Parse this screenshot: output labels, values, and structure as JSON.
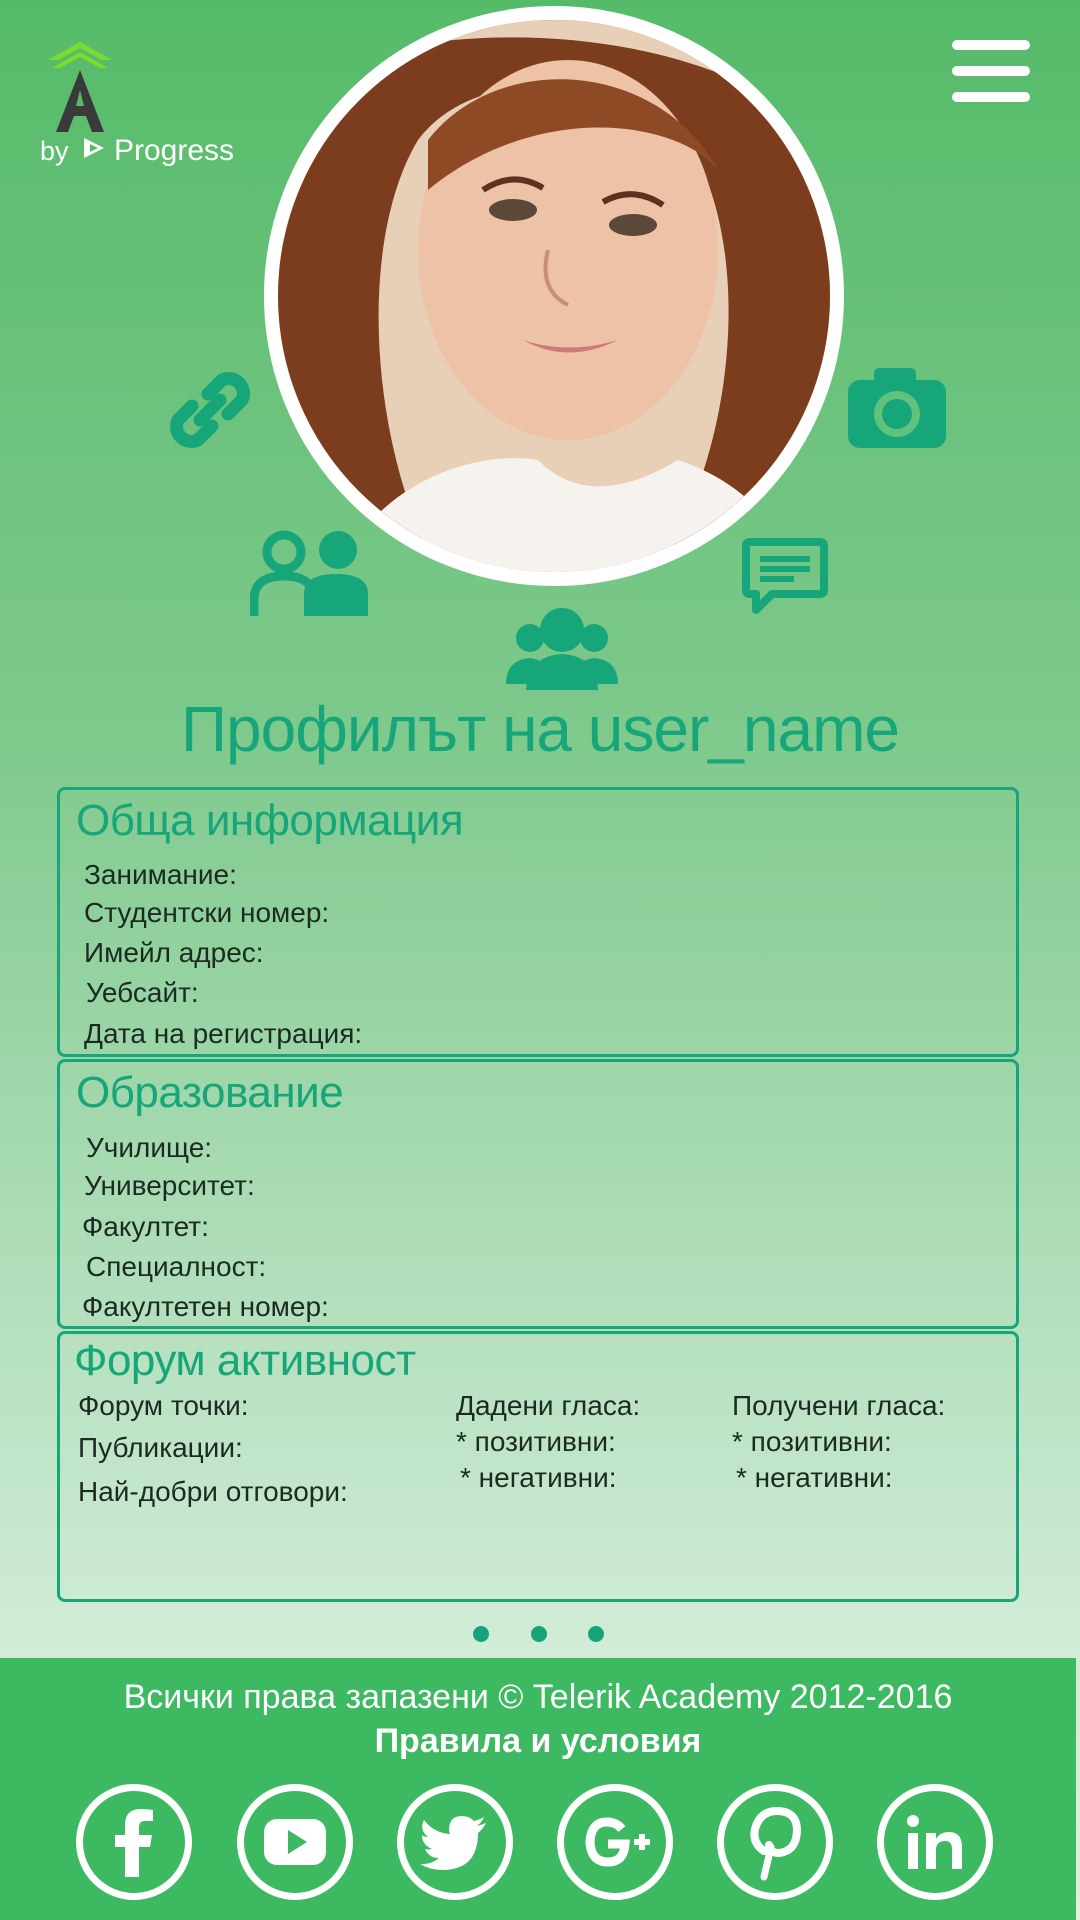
{
  "brand": {
    "by_text": "by",
    "progress_text": "Progress"
  },
  "profile": {
    "title": "Профилът на user_name"
  },
  "general": {
    "title": "Обща информация",
    "fields": [
      "Занимание:",
      "Студентски номер:",
      "Имейл адрес:",
      "Уебсайт:",
      "Дата на регистрация:"
    ]
  },
  "education": {
    "title": "Образование",
    "fields": [
      "Училище:",
      "Университет:",
      "Факултет:",
      "Специалност:",
      "Факултетен номер:"
    ]
  },
  "forum": {
    "title": "Форум активност",
    "left_fields": [
      "Форум точки:",
      "Публикации:",
      "Най-добри отговори:"
    ],
    "given": {
      "label": "Дадени гласа:",
      "positive": "* позитивни:",
      "negative": "* негативни:"
    },
    "received": {
      "label": "Получени гласа:",
      "positive": "* позитивни:",
      "negative": "* негативни:"
    }
  },
  "pager": {
    "pages": 3
  },
  "footer": {
    "copyright": "Всички права запазени © Telerik Academy 2012-2016",
    "terms": "Правила и условия",
    "social": [
      "facebook-icon",
      "youtube-icon",
      "twitter-icon",
      "google-plus-icon",
      "pinterest-icon",
      "linkedin-icon"
    ]
  },
  "colors": {
    "accent": "#17a67a",
    "header_green": "#55bb69",
    "footer_green": "#3cb961",
    "white": "#ffffff"
  }
}
